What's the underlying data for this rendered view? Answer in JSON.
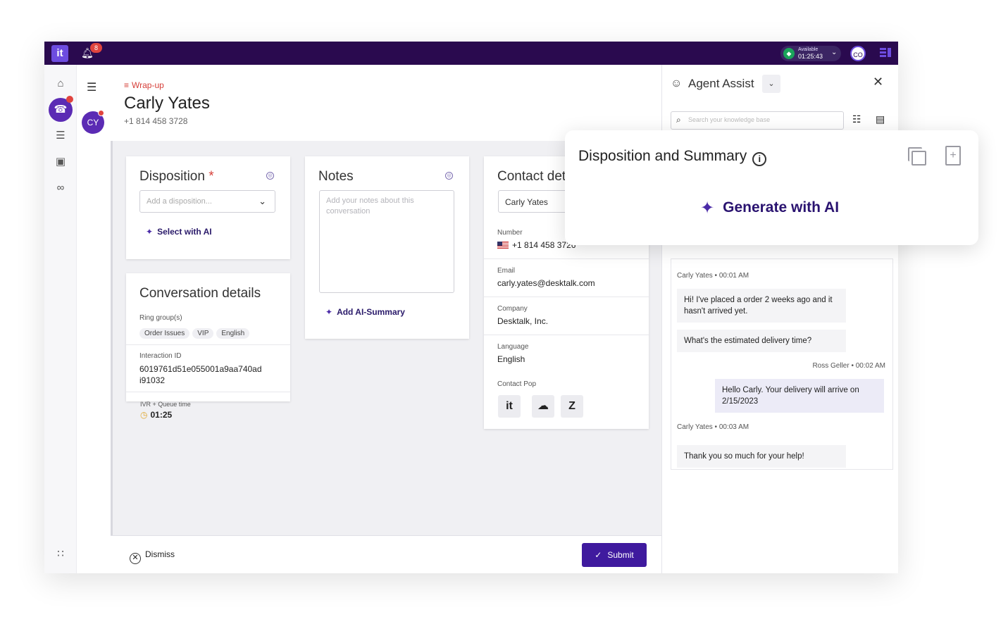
{
  "topbar": {
    "logo": "it",
    "notifications_count": "8",
    "status_label": "Available",
    "status_time": "01:25:43",
    "user_initials": "CO"
  },
  "header": {
    "wrapup_label": "Wrap-up",
    "customer_name": "Carly Yates",
    "customer_phone": "+1 814 458 3728",
    "avatar_initials": "CY"
  },
  "disposition": {
    "title": "Disposition",
    "required_mark": "*",
    "placeholder": "Add a disposition...",
    "select_ai_label": "Select with AI"
  },
  "conversation_details": {
    "title": "Conversation details",
    "ring_groups_label": "Ring group(s)",
    "ring_groups": [
      "Order Issues",
      "VIP",
      "English"
    ],
    "interaction_id_label": "Interaction ID",
    "interaction_id": "6019761d51e055001a9aa740ad i91032",
    "queue_time_label": "IVR + Queue time",
    "queue_time": "01:25"
  },
  "notes": {
    "title": "Notes",
    "placeholder": "Add your notes about this conversation",
    "add_summary_label": "Add AI-Summary"
  },
  "contact": {
    "title": "Contact det",
    "name": "Carly Yates",
    "number_label": "Number",
    "number": "+1 814 458 3726",
    "email_label": "Email",
    "email": "carly.yates@desktalk.com",
    "company_label": "Company",
    "company": "Desktalk, Inc.",
    "language_label": "Language",
    "language": "English",
    "contact_pop_label": "Contact Pop",
    "pop_icons": [
      "talkdesk-icon",
      "salesforce-icon",
      "zendesk-icon"
    ]
  },
  "footer": {
    "dismiss_label": "Dismiss",
    "submit_label": "Submit"
  },
  "agent_assist": {
    "title": "Agent Assist",
    "search_placeholder": "Search your knowledge base"
  },
  "popup": {
    "title": "Disposition and Summary",
    "generate_label": "Generate with AI"
  },
  "chat": [
    {
      "meta": "Carly Yates • 00:01  AM",
      "messages": [
        "Hi! I've placed a order 2 weeks ago and it hasn't arrived yet.",
        "What's the estimated delivery time?"
      ]
    },
    {
      "meta": "Ross Geller • 00:02  AM",
      "messages": [
        "Hello Carly. Your delivery will arrive on 2/15/2023"
      ]
    },
    {
      "meta": "Carly Yates • 00:03  AM",
      "messages": [
        "Thank you so much for your help!"
      ]
    }
  ],
  "colors": {
    "topbar": "#2a0a4f",
    "accent": "#3f1a9e",
    "required": "#d6403a",
    "status_available": "#1aa35a"
  }
}
